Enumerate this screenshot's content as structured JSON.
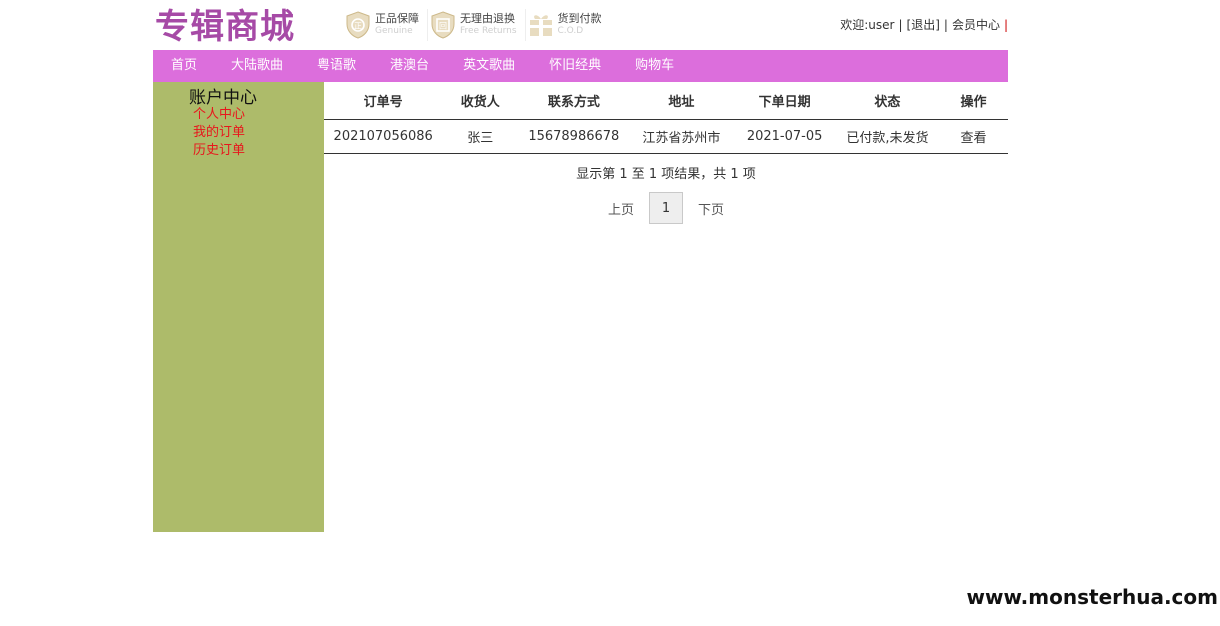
{
  "site": {
    "logo": "专辑商城"
  },
  "badges": [
    {
      "cn": "正品保障",
      "en": "Genuine",
      "icon": "shield-zheng-icon"
    },
    {
      "cn": "无理由退换",
      "en": "Free Returns",
      "icon": "shield-return-icon"
    },
    {
      "cn": "货到付款",
      "en": "C.O.D",
      "icon": "gift-box-icon"
    }
  ],
  "userbar": {
    "welcome": "欢迎:user",
    "logout": "[退出]",
    "member_center": "会员中心",
    "sep": "|",
    "trailing": "|"
  },
  "nav": [
    "首页",
    "大陆歌曲",
    "粤语歌",
    "港澳台",
    "英文歌曲",
    "怀旧经典",
    "购物车"
  ],
  "sidebar": {
    "title": "账户中心",
    "links": [
      "个人中心",
      "我的订单",
      "历史订单"
    ]
  },
  "table": {
    "headers": [
      "订单号",
      "收货人",
      "联系方式",
      "地址",
      "下单日期",
      "状态",
      "操作"
    ],
    "rows": [
      [
        "202107056086",
        "张三",
        "15678986678",
        "江苏省苏州市",
        "2021-07-05",
        "已付款,未发货",
        "查看"
      ]
    ]
  },
  "pagination": {
    "info": "显示第 1 至 1 项结果，共 1 项",
    "prev": "上页",
    "current": "1",
    "next": "下页"
  },
  "watermark": "www.monsterhua.com",
  "colors": {
    "nav": "#dc6edc",
    "sidebar": "#adbb6a",
    "logo": "#a64aa6",
    "link": "#e8161c"
  }
}
